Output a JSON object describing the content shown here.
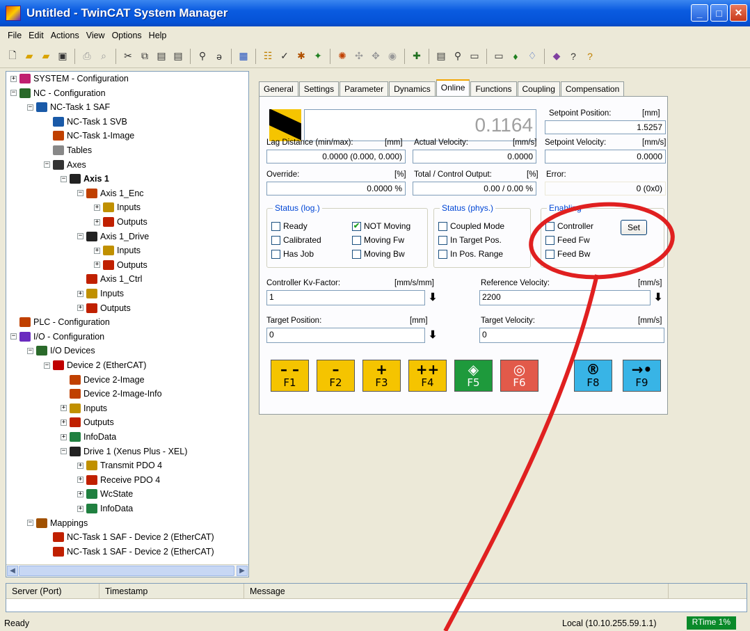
{
  "window": {
    "title": "Untitled - TwinCAT System Manager"
  },
  "menu": [
    "File",
    "Edit",
    "Actions",
    "View",
    "Options",
    "Help"
  ],
  "tree": [
    {
      "label": "SYSTEM - Configuration",
      "expander": "+"
    },
    {
      "label": "NC - Configuration",
      "expander": "-"
    },
    {
      "label": "NC-Task 1 SAF",
      "expander": "-"
    },
    {
      "label": "NC-Task 1 SVB",
      "expander": ""
    },
    {
      "label": "NC-Task 1-Image",
      "expander": ""
    },
    {
      "label": "Tables",
      "expander": ""
    },
    {
      "label": "Axes",
      "expander": "-"
    },
    {
      "label": "Axis 1",
      "expander": "-"
    },
    {
      "label": "Axis 1_Enc",
      "expander": "-"
    },
    {
      "label": "Inputs",
      "expander": "+"
    },
    {
      "label": "Outputs",
      "expander": "+"
    },
    {
      "label": "Axis 1_Drive",
      "expander": "-"
    },
    {
      "label": "Inputs",
      "expander": "+"
    },
    {
      "label": "Outputs",
      "expander": "+"
    },
    {
      "label": "Axis 1_Ctrl",
      "expander": ""
    },
    {
      "label": "Inputs",
      "expander": "+"
    },
    {
      "label": "Outputs",
      "expander": "+"
    },
    {
      "label": "PLC - Configuration",
      "expander": ""
    },
    {
      "label": "I/O - Configuration",
      "expander": "-"
    },
    {
      "label": "I/O Devices",
      "expander": "-"
    },
    {
      "label": "Device 2 (EtherCAT)",
      "expander": "-"
    },
    {
      "label": "Device 2-Image",
      "expander": ""
    },
    {
      "label": "Device 2-Image-Info",
      "expander": ""
    },
    {
      "label": "Inputs",
      "expander": "+"
    },
    {
      "label": "Outputs",
      "expander": "+"
    },
    {
      "label": "InfoData",
      "expander": "+"
    },
    {
      "label": "Drive 1 (Xenus Plus - XEL)",
      "expander": "-"
    },
    {
      "label": "Transmit PDO 4",
      "expander": "+"
    },
    {
      "label": "Receive PDO 4",
      "expander": "+"
    },
    {
      "label": "WcState",
      "expander": "+"
    },
    {
      "label": "InfoData",
      "expander": "+"
    },
    {
      "label": "Mappings",
      "expander": "-"
    },
    {
      "label": "NC-Task 1 SAF - Device 2 (EtherCAT)",
      "expander": ""
    },
    {
      "label": "NC-Task 1 SAF - Device 2 (EtherCAT)",
      "expander": ""
    }
  ],
  "tabs": [
    "General",
    "Settings",
    "Parameter",
    "Dynamics",
    "Online",
    "Functions",
    "Coupling",
    "Compensation"
  ],
  "online": {
    "actual_position": "0.1164",
    "setpoint_position_label": "Setpoint Position:",
    "setpoint_position_unit": "[mm]",
    "setpoint_position": "1.5257",
    "lag_label": "Lag Distance (min/max):",
    "lag_unit": "[mm]",
    "lag_value": "0.0000  (0.000, 0.000)",
    "actual_velocity_label": "Actual Velocity:",
    "actual_velocity_unit": "[mm/s]",
    "actual_velocity": "0.0000",
    "setpoint_velocity_label": "Setpoint Velocity:",
    "setpoint_velocity_unit": "[mm/s]",
    "setpoint_velocity": "0.0000",
    "override_label": "Override:",
    "override_unit": "[%]",
    "override_value": "0.0000 %",
    "output_label": "Total / Control Output:",
    "output_unit": "[%]",
    "output_value": "0.00 /  0.00 %",
    "error_label": "Error:",
    "error_value": "0 (0x0)",
    "status_log_title": "Status (log.)",
    "status_phys_title": "Status (phys.)",
    "enabling_title": "Enabling",
    "cb_ready": "Ready",
    "cb_calibrated": "Calibrated",
    "cb_has_job": "Has Job",
    "cb_not_moving": "NOT Moving",
    "cb_moving_fw": "Moving Fw",
    "cb_moving_bw": "Moving Bw",
    "cb_coupled": "Coupled Mode",
    "cb_in_target": "In Target Pos.",
    "cb_in_range": "In Pos. Range",
    "cb_controller": "Controller",
    "cb_feed_fw": "Feed Fw",
    "cb_feed_bw": "Feed Bw",
    "set_button": "Set",
    "kv_label": "Controller Kv-Factor:",
    "kv_unit": "[mm/s/mm]",
    "kv_value": "1",
    "ref_vel_label": "Reference Velocity:",
    "ref_vel_unit": "[mm/s]",
    "ref_vel_value": "2200",
    "target_pos_label": "Target Position:",
    "target_pos_unit": "[mm]",
    "target_pos_value": "0",
    "target_vel_label": "Target Velocity:",
    "target_vel_unit": "[mm/s]",
    "target_vel_value": "0"
  },
  "fkeys": [
    {
      "sym": "– –",
      "label": "F1"
    },
    {
      "sym": "–",
      "label": "F2"
    },
    {
      "sym": "+",
      "label": "F3"
    },
    {
      "sym": "++",
      "label": "F4"
    },
    {
      "sym": "◈",
      "label": "F5"
    },
    {
      "sym": "◎",
      "label": "F6"
    },
    {
      "sym": "®",
      "label": "F8"
    },
    {
      "sym": "→•",
      "label": "F9"
    }
  ],
  "messages": {
    "col_server": "Server (Port)",
    "col_timestamp": "Timestamp",
    "col_message": "Message"
  },
  "status": {
    "left": "Ready",
    "local": "Local (10.10.255.59.1.1)",
    "rtime": "RTime 1%"
  },
  "colors": {
    "fkey_yellow": "#f5c400",
    "fkey_green": "#1e9a3c",
    "fkey_red": "#e25a4a",
    "fkey_blue": "#38b4e6",
    "annotation": "#e02020"
  }
}
